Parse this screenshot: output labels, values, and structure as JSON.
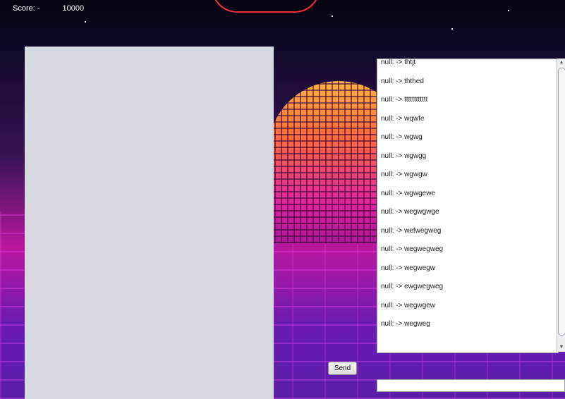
{
  "score": {
    "label": "Score: -",
    "value": "10000"
  },
  "chat": {
    "messages": [
      "null: -> thtjt",
      "null: -> ththed",
      "null: -> tttttttttttt",
      "null: -> wqwfe",
      "null: -> wgwg",
      "null: -> wgwgg",
      "null: -> wgwgw",
      "null: -> wgwgewe",
      "null: -> wegwgwge",
      "null: -> wefwegweg",
      "null: -> wegwegweg",
      "null: -> wegwegw",
      "null: -> ewgwegweg",
      "null: -> wegwgew",
      "null: -> wegweg"
    ]
  },
  "scrollbar": {
    "up_arrow": "▲",
    "down_arrow": "▼"
  },
  "controls": {
    "send_label": "Send",
    "input_value": ""
  }
}
